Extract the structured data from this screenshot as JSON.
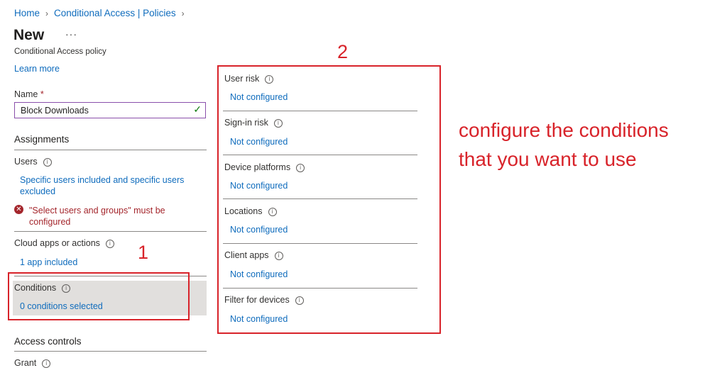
{
  "breadcrumb": [
    "Home",
    "Conditional Access | Policies"
  ],
  "page": {
    "title": "New",
    "more_label": "···",
    "subtitle": "Conditional Access policy",
    "learn_more": "Learn more"
  },
  "name_field": {
    "label": "Name",
    "required_mark": "*",
    "value": "Block Downloads"
  },
  "assignments": {
    "heading": "Assignments",
    "users": {
      "label": "Users",
      "value": "Specific users included and specific users excluded",
      "error": "\"Select users and groups\" must be configured"
    },
    "cloud_apps": {
      "label": "Cloud apps or actions",
      "value": "1 app included"
    },
    "conditions": {
      "label": "Conditions",
      "value": "0 conditions selected"
    }
  },
  "access_controls": {
    "heading": "Access controls",
    "grant_label": "Grant"
  },
  "conditions_panel": [
    {
      "label": "User risk",
      "value": "Not configured"
    },
    {
      "label": "Sign-in risk",
      "value": "Not configured"
    },
    {
      "label": "Device platforms",
      "value": "Not configured"
    },
    {
      "label": "Locations",
      "value": "Not configured"
    },
    {
      "label": "Client apps",
      "value": "Not configured"
    },
    {
      "label": "Filter for devices",
      "value": "Not configured"
    }
  ],
  "annotations": {
    "step1": "1",
    "step2": "2",
    "note_line1": "configure the conditions",
    "note_line2": "that you want to use"
  },
  "colors": {
    "link": "#0f6cbd",
    "annotation": "#d8232a",
    "error": "#a4262c"
  },
  "icons": [
    "chevron-right-icon",
    "info-icon",
    "checkmark-icon",
    "error-icon"
  ]
}
